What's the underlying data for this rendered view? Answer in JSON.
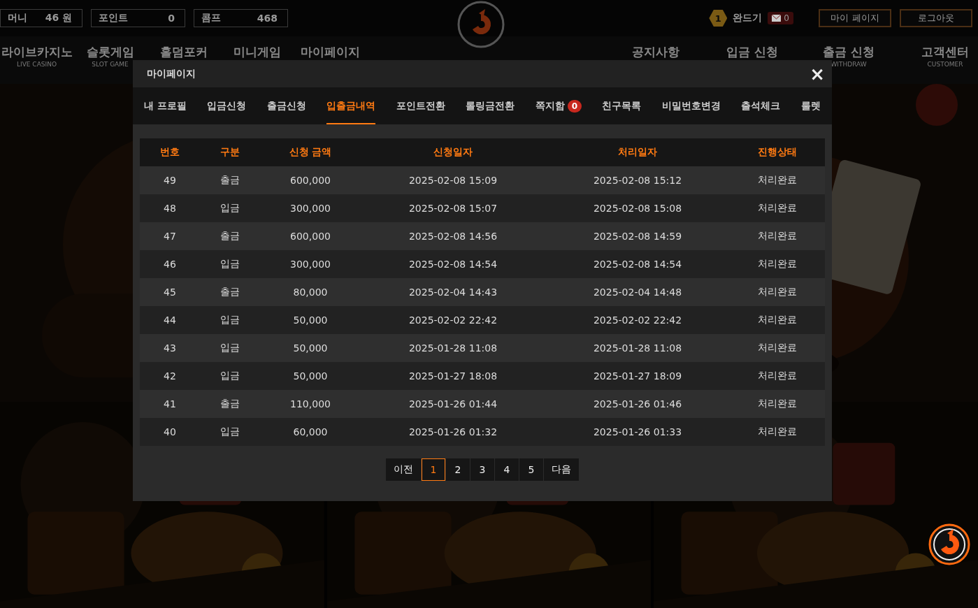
{
  "top_bar": {
    "stats": [
      {
        "label": "머니",
        "value": "46 원"
      },
      {
        "label": "포인트",
        "value": "0"
      },
      {
        "label": "콤프",
        "value": "468"
      }
    ],
    "user": {
      "level": "1",
      "name": "완드기",
      "messages": "0"
    },
    "buttons": [
      "마이 페이지",
      "로그아웃"
    ]
  },
  "nav": {
    "left": [
      {
        "label": "라이브카지노",
        "sub": "LIVE CASINO"
      },
      {
        "label": "슬롯게임",
        "sub": "SLOT GAME"
      },
      {
        "label": "홀덤포커"
      },
      {
        "label": "미니게임"
      },
      {
        "label": "마이페이지"
      }
    ],
    "right": [
      {
        "label": "공지사항"
      },
      {
        "label": "입금 신청"
      },
      {
        "label": "출금 신청",
        "sub": "WITHDRAW"
      },
      {
        "label": "고객센터",
        "sub": "CUSTOMER"
      }
    ]
  },
  "modal": {
    "title": "마이페이지",
    "close": "×",
    "tabs": [
      {
        "label": "내 프로필",
        "selected": false
      },
      {
        "label": "입금신청",
        "selected": false
      },
      {
        "label": "출금신청",
        "selected": false
      },
      {
        "label": "입출금내역",
        "selected": true
      },
      {
        "label": "포인트전환",
        "selected": false
      },
      {
        "label": "롤링금전환",
        "selected": false
      },
      {
        "label": "쪽지함",
        "selected": false,
        "badge": "0"
      },
      {
        "label": "친구목록",
        "selected": false
      },
      {
        "label": "비밀번호변경",
        "selected": false
      },
      {
        "label": "출석체크",
        "selected": false
      },
      {
        "label": "룰렛",
        "selected": false
      }
    ],
    "table": {
      "columns": [
        "번호",
        "구분",
        "신청 금액",
        "신청일자",
        "처리일자",
        "진행상태"
      ],
      "rows": [
        [
          "49",
          "출금",
          "600,000",
          "2025-02-08 15:09",
          "2025-02-08 15:12",
          "처리완료"
        ],
        [
          "48",
          "입금",
          "300,000",
          "2025-02-08 15:07",
          "2025-02-08 15:08",
          "처리완료"
        ],
        [
          "47",
          "출금",
          "600,000",
          "2025-02-08 14:56",
          "2025-02-08 14:59",
          "처리완료"
        ],
        [
          "46",
          "입금",
          "300,000",
          "2025-02-08 14:54",
          "2025-02-08 14:54",
          "처리완료"
        ],
        [
          "45",
          "출금",
          "80,000",
          "2025-02-04 14:43",
          "2025-02-04 14:48",
          "처리완료"
        ],
        [
          "44",
          "입금",
          "50,000",
          "2025-02-02 22:42",
          "2025-02-02 22:42",
          "처리완료"
        ],
        [
          "43",
          "입금",
          "50,000",
          "2025-01-28 11:08",
          "2025-01-28 11:08",
          "처리완료"
        ],
        [
          "42",
          "입금",
          "50,000",
          "2025-01-27 18:08",
          "2025-01-27 18:09",
          "처리완료"
        ],
        [
          "41",
          "출금",
          "110,000",
          "2025-01-26 01:44",
          "2025-01-26 01:46",
          "처리완료"
        ],
        [
          "40",
          "입금",
          "60,000",
          "2025-01-26 01:32",
          "2025-01-26 01:33",
          "처리완료"
        ]
      ]
    },
    "pagination": {
      "prev": "이전",
      "next": "다음",
      "pages": [
        {
          "label": "1",
          "selected": true
        },
        {
          "label": "2",
          "selected": false
        },
        {
          "label": "3",
          "selected": false
        },
        {
          "label": "4",
          "selected": false
        },
        {
          "label": "5",
          "selected": false
        }
      ]
    }
  }
}
